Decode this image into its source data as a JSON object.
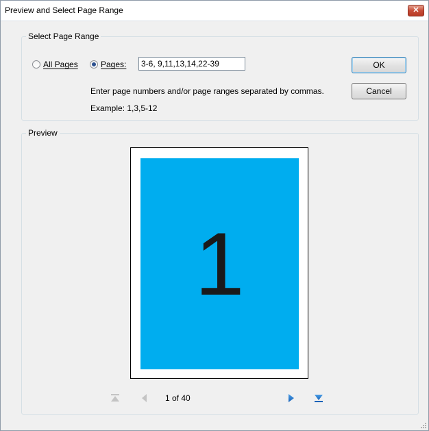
{
  "window": {
    "title": "Preview and Select Page Range",
    "close_glyph": "✕"
  },
  "range_group": {
    "legend": "Select Page Range",
    "all_pages_label": "All Pages",
    "pages_label": "Pages:",
    "pages_value": "3-6, 9,11,13,14,22-39",
    "hint": "Enter page numbers and/or page ranges separated by commas.",
    "example": "Example: 1,3,5-12",
    "selected": "pages"
  },
  "buttons": {
    "ok_label": "OK",
    "cancel_label": "Cancel"
  },
  "preview": {
    "legend": "Preview",
    "page_number": "1",
    "page_color": "#00adef",
    "counter": "1 of 40"
  },
  "icons": {
    "first": "first-page-icon",
    "prev": "previous-page-icon",
    "next": "next-page-icon",
    "last": "last-page-icon"
  }
}
